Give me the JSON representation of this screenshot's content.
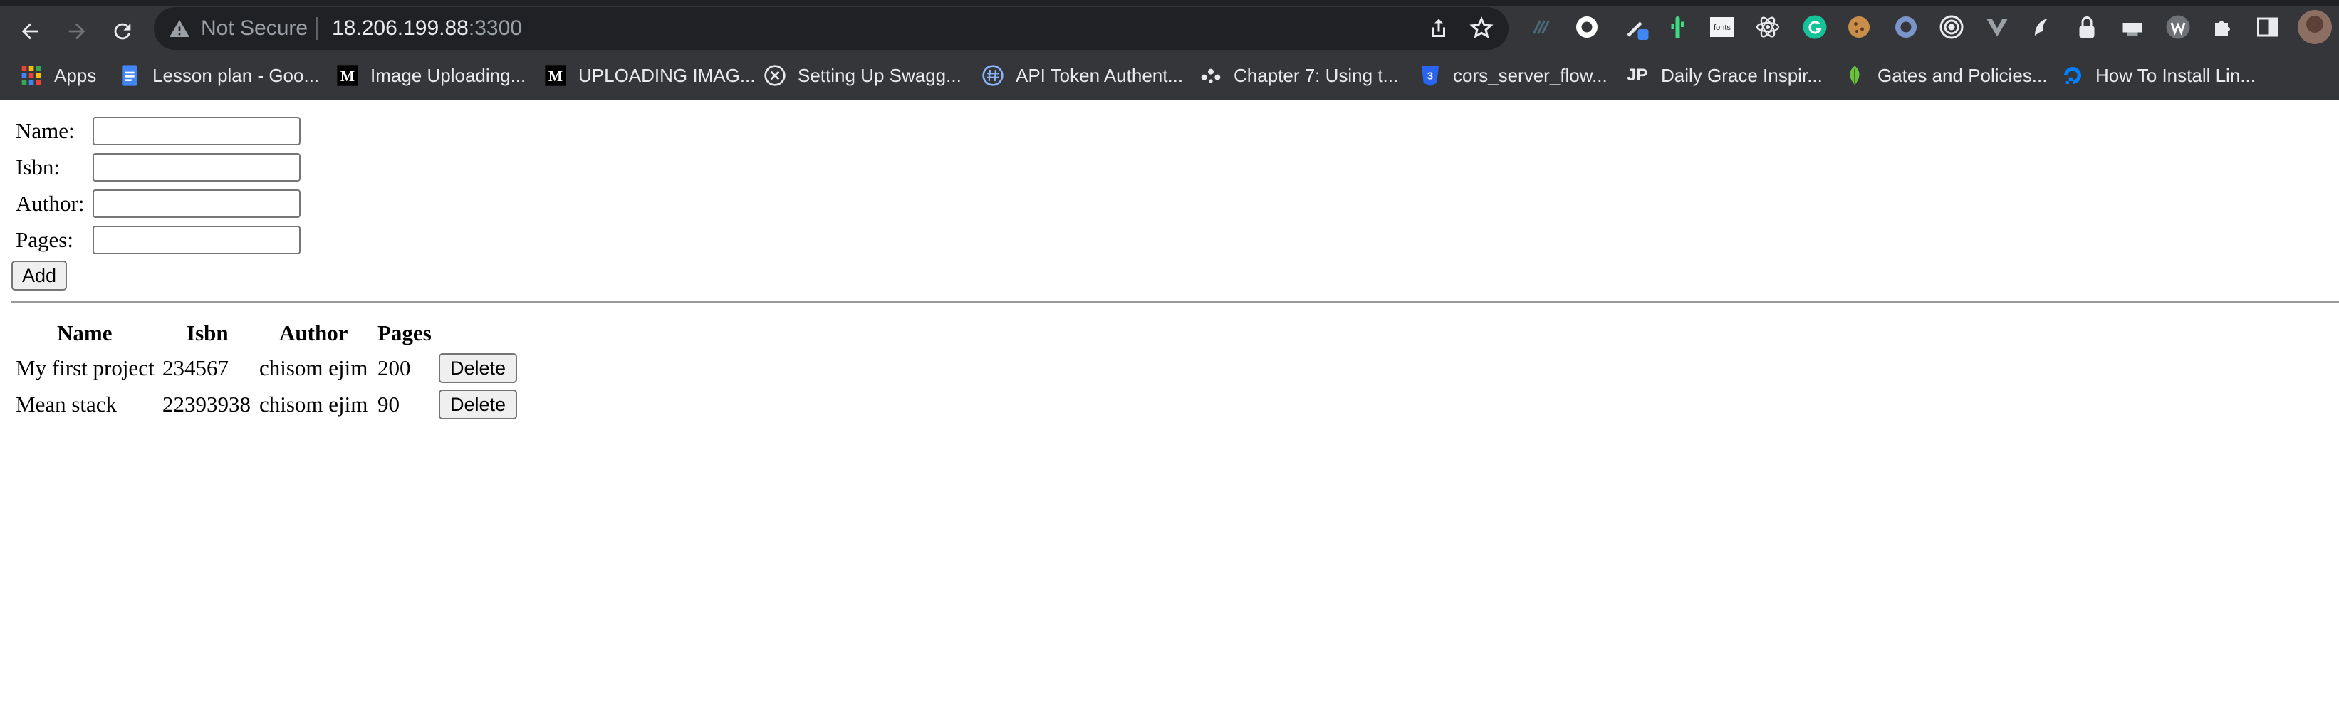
{
  "browser": {
    "not_secure_label": "Not Secure",
    "url_host": "18.206.199.88",
    "url_port": ":3300",
    "extensions": [
      "tailwind-icon",
      "record-icon",
      "eyedropper-icon",
      "cactus-icon",
      "fonts-icon",
      "react-devtools-icon",
      "grammarly-icon",
      "cookie-icon",
      "vpn-icon",
      "target-icon",
      "vue-devtools-icon",
      "dark-reader-icon",
      "lock-icon",
      "screen-capture-icon",
      "wappalyzer-icon",
      "puzzle-icon"
    ],
    "fonts_ext_label": "fonts",
    "bookmarks": [
      {
        "label": "Apps",
        "icon": "apps-grid-icon"
      },
      {
        "label": "Lesson plan - Goo...",
        "icon": "google-docs-icon"
      },
      {
        "label": "Image Uploading...",
        "icon": "medium-icon"
      },
      {
        "label": "UPLOADING IMAG...",
        "icon": "medium-icon"
      },
      {
        "label": "Setting Up Swagg...",
        "icon": "swagger-icon"
      },
      {
        "label": "API Token Authent...",
        "icon": "hashnode-icon"
      },
      {
        "label": "Chapter 7: Using t...",
        "icon": "dots-icon"
      },
      {
        "label": "cors_server_flow...",
        "icon": "css3-icon"
      },
      {
        "label": "Daily Grace Inspir...",
        "icon": "jp-icon"
      },
      {
        "label": "Gates and Policies...",
        "icon": "leaf-icon"
      },
      {
        "label": "How To Install Lin...",
        "icon": "digitalocean-icon"
      }
    ],
    "jp_text": "JP"
  },
  "form": {
    "name_label": "Name:",
    "isbn_label": "Isbn:",
    "author_label": "Author:",
    "pages_label": "Pages:",
    "name_value": "",
    "isbn_value": "",
    "author_value": "",
    "pages_value": "",
    "add_label": "Add"
  },
  "table": {
    "headers": [
      "Name",
      "Isbn",
      "Author",
      "Pages"
    ],
    "rows": [
      {
        "name": "My first project",
        "isbn": "234567",
        "author": "chisom ejim",
        "pages": "200",
        "action": "Delete"
      },
      {
        "name": "Mean stack",
        "isbn": "22393938",
        "author": "chisom ejim",
        "pages": "90",
        "action": "Delete"
      }
    ]
  },
  "colors": {
    "chrome_bg": "#35363a",
    "omnibox_bg": "#202124",
    "page_bg": "#ffffff"
  }
}
